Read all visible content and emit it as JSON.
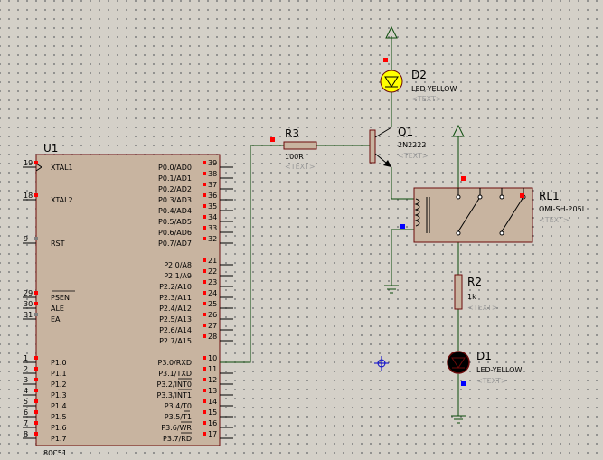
{
  "components": {
    "u1": {
      "ref": "U1",
      "part": "80C51",
      "left_pins": [
        {
          "num": "19",
          "name": "XTAL1"
        },
        {
          "num": "18",
          "name": "XTAL2"
        },
        {
          "num": "9",
          "name": "RST"
        },
        {
          "num": "29",
          "name": "PSEN"
        },
        {
          "num": "30",
          "name": "ALE"
        },
        {
          "num": "31",
          "name": "EA"
        },
        {
          "num": "1",
          "name": "P1.0"
        },
        {
          "num": "2",
          "name": "P1.1"
        },
        {
          "num": "3",
          "name": "P1.2"
        },
        {
          "num": "4",
          "name": "P1.3"
        },
        {
          "num": "5",
          "name": "P1.4"
        },
        {
          "num": "6",
          "name": "P1.5"
        },
        {
          "num": "7",
          "name": "P1.6"
        },
        {
          "num": "8",
          "name": "P1.7"
        }
      ],
      "right_pins": [
        {
          "num": "39",
          "name": "P0.0/AD0"
        },
        {
          "num": "38",
          "name": "P0.1/AD1"
        },
        {
          "num": "37",
          "name": "P0.2/AD2"
        },
        {
          "num": "36",
          "name": "P0.3/AD3"
        },
        {
          "num": "35",
          "name": "P0.4/AD4"
        },
        {
          "num": "34",
          "name": "P0.5/AD5"
        },
        {
          "num": "33",
          "name": "P0.6/AD6"
        },
        {
          "num": "32",
          "name": "P0.7/AD7"
        },
        {
          "num": "21",
          "name": "P2.0/A8"
        },
        {
          "num": "22",
          "name": "P2.1/A9"
        },
        {
          "num": "23",
          "name": "P2.2/A10"
        },
        {
          "num": "24",
          "name": "P2.3/A11"
        },
        {
          "num": "25",
          "name": "P2.4/A12"
        },
        {
          "num": "26",
          "name": "P2.5/A13"
        },
        {
          "num": "27",
          "name": "P2.6/A14"
        },
        {
          "num": "28",
          "name": "P2.7/A15"
        },
        {
          "num": "10",
          "name": "P3.0/RXD"
        },
        {
          "num": "11",
          "name": "P3.1/TXD"
        },
        {
          "num": "12",
          "name": "P3.2/INT0"
        },
        {
          "num": "13",
          "name": "P3.3/INT1"
        },
        {
          "num": "14",
          "name": "P3.4/T0"
        },
        {
          "num": "15",
          "name": "P3.5/T1"
        },
        {
          "num": "16",
          "name": "P3.6/WR"
        },
        {
          "num": "17",
          "name": "P3.7/RD"
        }
      ]
    },
    "r3": {
      "ref": "R3",
      "value": "100R",
      "text": "<TEXT>"
    },
    "q1": {
      "ref": "Q1",
      "value": "2N2222",
      "text": "<TEXT>"
    },
    "d2": {
      "ref": "D2",
      "value": "LED-YELLOW",
      "text": "<TEXT>",
      "color": "#ffff00"
    },
    "rl1": {
      "ref": "RL1",
      "value": "OMI-SH-205L",
      "text": "<TEXT>"
    },
    "r2": {
      "ref": "R2",
      "value": "1k",
      "text": "<TEXT>"
    },
    "d1": {
      "ref": "D1",
      "value": "LED-YELLOW",
      "text": "<TEXT>",
      "color": "#000000"
    }
  },
  "colors": {
    "wire": "#0a4a0a",
    "body": "#c8b4a0",
    "body_border": "#6b0a0a",
    "pin_marker": "#ff0000",
    "input_marker": "#0000ff"
  },
  "icons": {
    "power": "power-arrow-icon",
    "ground": "ground-icon",
    "origin": "origin-marker-icon"
  }
}
